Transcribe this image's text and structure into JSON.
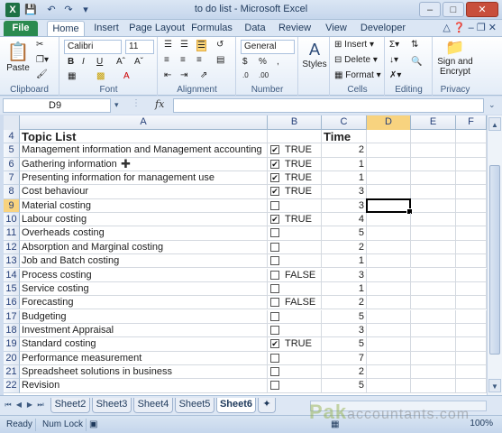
{
  "window": {
    "title": "to do list - Microsoft Excel",
    "app_icon": "X"
  },
  "ribbon": {
    "tabs": [
      "File",
      "Home",
      "Insert",
      "Page Layout",
      "Formulas",
      "Data",
      "Review",
      "View",
      "Developer"
    ],
    "active_tab": "Home",
    "groups": {
      "clipboard": {
        "label": "Clipboard",
        "paste": "Paste"
      },
      "font": {
        "label": "Font",
        "font_name": "Calibri",
        "font_size": "11"
      },
      "alignment": {
        "label": "Alignment"
      },
      "number": {
        "label": "Number",
        "format": "General"
      },
      "styles": {
        "label": "",
        "styles_btn": "Styles"
      },
      "cells": {
        "label": "Cells",
        "insert": "Insert",
        "delete": "Delete",
        "format": "Format"
      },
      "editing": {
        "label": "Editing"
      },
      "privacy": {
        "label": "Privacy",
        "sign_line1": "Sign and",
        "sign_line2": "Encrypt"
      }
    }
  },
  "formula_bar": {
    "name_box": "D9",
    "fx": "fx",
    "content": ""
  },
  "columns": [
    "A",
    "B",
    "C",
    "D",
    "E",
    "F"
  ],
  "selected_column": "D",
  "selected_row": "9",
  "rows": [
    {
      "num": "4",
      "a": "Topic List",
      "b_checkbox": false,
      "b_checked": false,
      "b": "",
      "c": "Time",
      "header": true
    },
    {
      "num": "5",
      "a": "Management information and Management accounting",
      "b_checkbox": true,
      "b_checked": true,
      "b": "TRUE",
      "c": "2"
    },
    {
      "num": "6",
      "a": "Gathering information",
      "b_checkbox": true,
      "b_checked": true,
      "b": "TRUE",
      "c": "1"
    },
    {
      "num": "7",
      "a": "Presenting information for management use",
      "b_checkbox": true,
      "b_checked": true,
      "b": "TRUE",
      "c": "1"
    },
    {
      "num": "8",
      "a": "Cost behaviour",
      "b_checkbox": true,
      "b_checked": true,
      "b": "TRUE",
      "c": "3"
    },
    {
      "num": "9",
      "a": "Material costing",
      "b_checkbox": true,
      "b_checked": false,
      "b": "",
      "c": "3"
    },
    {
      "num": "10",
      "a": "Labour costing",
      "b_checkbox": true,
      "b_checked": true,
      "b": "TRUE",
      "c": "4"
    },
    {
      "num": "11",
      "a": "Overheads costing",
      "b_checkbox": true,
      "b_checked": false,
      "b": "",
      "c": "5"
    },
    {
      "num": "12",
      "a": "Absorption and Marginal costing",
      "b_checkbox": true,
      "b_checked": false,
      "b": "",
      "c": "2"
    },
    {
      "num": "13",
      "a": "Job and Batch costing",
      "b_checkbox": true,
      "b_checked": false,
      "b": "",
      "c": "1"
    },
    {
      "num": "14",
      "a": "Process costing",
      "b_checkbox": true,
      "b_checked": false,
      "b": "FALSE",
      "c": "3"
    },
    {
      "num": "15",
      "a": "Service costing",
      "b_checkbox": true,
      "b_checked": false,
      "b": "",
      "c": "1"
    },
    {
      "num": "16",
      "a": "Forecasting",
      "b_checkbox": true,
      "b_checked": false,
      "b": "FALSE",
      "c": "2"
    },
    {
      "num": "17",
      "a": "Budgeting",
      "b_checkbox": true,
      "b_checked": false,
      "b": "",
      "c": "5"
    },
    {
      "num": "18",
      "a": "Investment Appraisal",
      "b_checkbox": true,
      "b_checked": false,
      "b": "",
      "c": "3"
    },
    {
      "num": "19",
      "a": "Standard costing",
      "b_checkbox": true,
      "b_checked": true,
      "b": "TRUE",
      "c": "5"
    },
    {
      "num": "20",
      "a": "Performance measurement",
      "b_checkbox": true,
      "b_checked": false,
      "b": "",
      "c": "7"
    },
    {
      "num": "21",
      "a": "Spreadsheet solutions in business",
      "b_checkbox": true,
      "b_checked": false,
      "b": "",
      "c": "2"
    },
    {
      "num": "22",
      "a": "Revision",
      "b_checkbox": true,
      "b_checked": false,
      "b": "",
      "c": "5"
    }
  ],
  "sheets": [
    "Sheet2",
    "Sheet3",
    "Sheet4",
    "Sheet5",
    "Sheet6"
  ],
  "active_sheet": "Sheet6",
  "status": {
    "ready": "Ready",
    "numlock": "Num Lock",
    "zoom": "100%"
  },
  "watermark": {
    "brand": "Pak",
    "rest": "accountants.com"
  }
}
